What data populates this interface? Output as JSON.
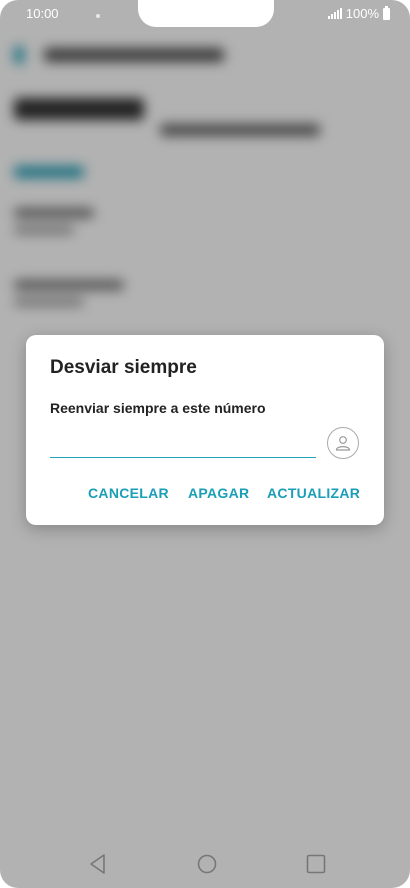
{
  "status_bar": {
    "time": "10:00",
    "battery_label": "100%"
  },
  "dialog": {
    "title": "Desviar siempre",
    "label": "Reenviar siempre a este número",
    "input_value": "",
    "input_placeholder": "",
    "buttons": {
      "cancel": "CANCELAR",
      "turn_off": "APAGAR",
      "update": "ACTUALIZAR"
    }
  },
  "colors": {
    "accent": "#1a9fb6",
    "input_underline": "#1fa3b5",
    "title_text": "#222222",
    "scrim": "#b3b3b3"
  },
  "icons": {
    "contact": "person-icon",
    "back": "triangle-back-icon",
    "home": "circle-home-icon",
    "recents": "square-recents-icon"
  }
}
